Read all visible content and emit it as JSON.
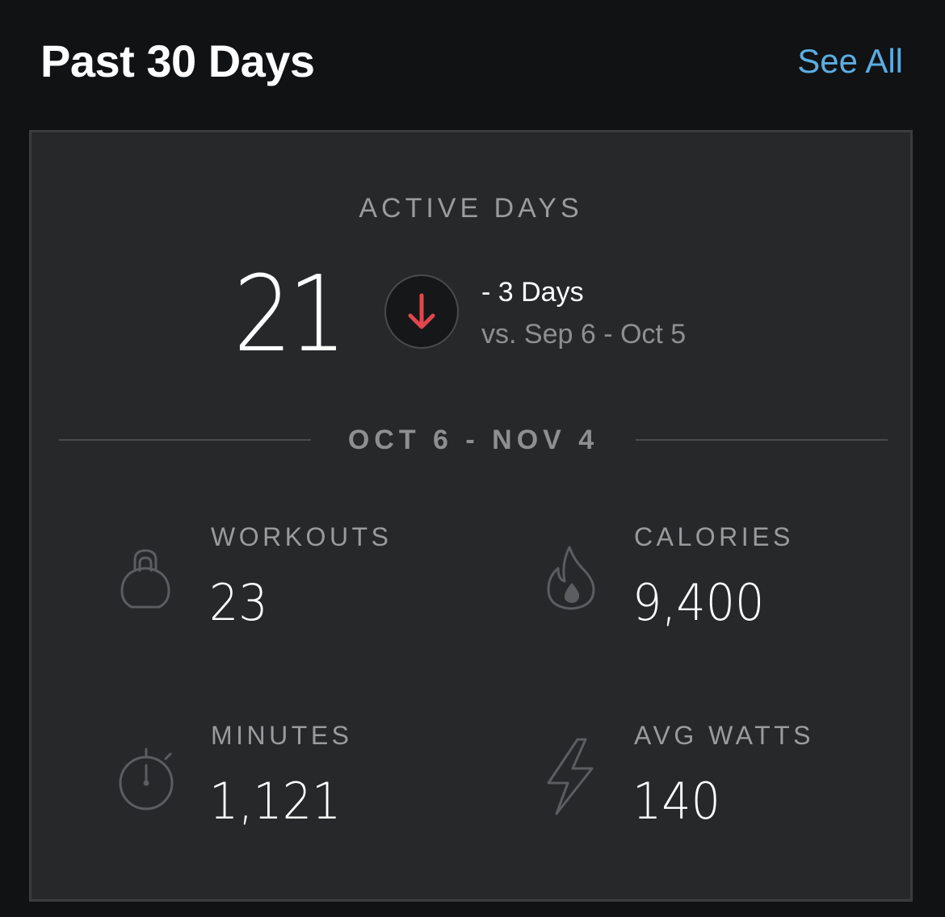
{
  "header": {
    "title": "Past 30 Days",
    "see_all_label": "See All"
  },
  "colors": {
    "background": "#111214",
    "card": "#27282a",
    "accent_link": "#5aaee2",
    "trend_down": "#e0474c",
    "label_gray": "#9a9b9d"
  },
  "active_days": {
    "label": "ACTIVE DAYS",
    "value": "21",
    "trend_icon": "arrow-down-icon",
    "delta": "- 3 Days",
    "comparison": "vs. Sep 6 - Oct 5"
  },
  "period": {
    "range": "OCT 6 - NOV 4"
  },
  "stats": {
    "workouts": {
      "label": "WORKOUTS",
      "value": "23",
      "icon": "kettlebell-icon"
    },
    "calories": {
      "label": "CALORIES",
      "value": "9,400",
      "icon": "flame-icon"
    },
    "minutes": {
      "label": "MINUTES",
      "value": "1,121",
      "icon": "stopwatch-icon"
    },
    "avg_watts": {
      "label": "AVG WATTS",
      "value": "140",
      "icon": "lightning-bolt-icon"
    }
  }
}
